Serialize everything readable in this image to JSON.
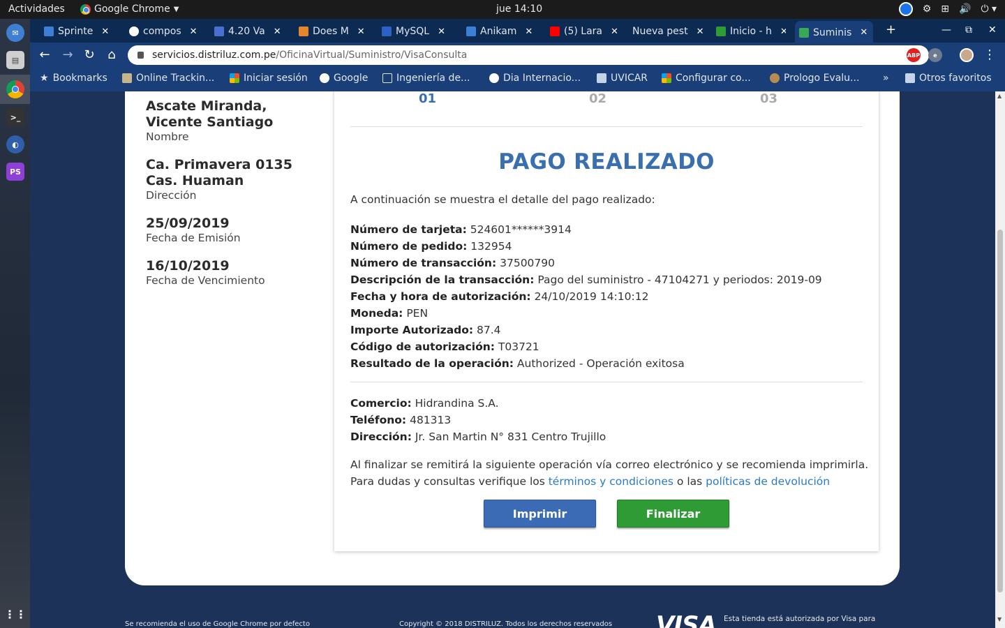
{
  "topbar": {
    "activities": "Actividades",
    "app_name": "Google Chrome",
    "clock": "jue 14:10"
  },
  "tabs": [
    {
      "label": "Sprinte",
      "color": "#3d7fd4"
    },
    {
      "label": "compos",
      "color": "#ffffff"
    },
    {
      "label": "4.20 Va",
      "color": "#4a6fd1"
    },
    {
      "label": "Does M",
      "color": "#e6862c"
    },
    {
      "label": "MySQL",
      "color": "#2d62c4"
    },
    {
      "label": "Anikam",
      "color": "#3d7fd4"
    },
    {
      "label": "(5) Lara",
      "color": "#ff0000"
    },
    {
      "label": "Nueva pest",
      "color": ""
    },
    {
      "label": "Inicio - h",
      "color": "#2e9b34"
    },
    {
      "label": "Suminis",
      "color": "#3aa957"
    }
  ],
  "omnibox": {
    "domain": "servicios.distriluz.com.pe",
    "path": "/OficinaVirtual/Suministro/VisaConsulta"
  },
  "bookmarks": [
    {
      "label": "Bookmarks"
    },
    {
      "label": "Online Trackin..."
    },
    {
      "label": "Iniciar sesión"
    },
    {
      "label": "Google"
    },
    {
      "label": "Ingeniería de..."
    },
    {
      "label": "Dia Internacio..."
    },
    {
      "label": "UVICAR"
    },
    {
      "label": "Configurar co..."
    },
    {
      "label": "Prologo Evalu..."
    },
    {
      "label": "Otros favoritos"
    }
  ],
  "customer": {
    "name": "Ascate Miranda, Vicente Santiago",
    "name_label": "Nombre",
    "address": "Ca. Primavera 0135 Cas. Huaman",
    "address_label": "Dirección",
    "issue_date": "25/09/2019",
    "issue_label": "Fecha de Emisión",
    "due_date": "16/10/2019",
    "due_label": "Fecha de Vencimiento"
  },
  "steps": [
    "01",
    "02",
    "03"
  ],
  "payment": {
    "title": "PAGO REALIZADO",
    "intro": "A continuación se muestra el detalle del pago realizado:",
    "rows": [
      {
        "label": "Número de tarjeta:",
        "value": "524601******3914"
      },
      {
        "label": "Número de pedido:",
        "value": "132954"
      },
      {
        "label": "Número de transacción:",
        "value": "37500790"
      },
      {
        "label": "Descripción de la transacción:",
        "value": "Pago del suministro - 47104271 y periodos: 2019-09"
      },
      {
        "label": "Fecha y hora de autorización:",
        "value": "24/10/2019 14:10:12"
      },
      {
        "label": "Moneda:",
        "value": "PEN"
      },
      {
        "label": "Importe Autorizado:",
        "value": "87.4"
      },
      {
        "label": "Código de autorización:",
        "value": "T03721"
      },
      {
        "label": "Resultado de la operación:",
        "value": "Authorized - Operación exitosa"
      }
    ],
    "merchant": [
      {
        "label": "Comercio:",
        "value": "Hidrandina S.A."
      },
      {
        "label": "Teléfono:",
        "value": "481313"
      },
      {
        "label": "Dirección:",
        "value": "Jr. San Martin N° 831 Centro Trujillo"
      }
    ],
    "note_line1": "Al finalizar se remitirá la siguiente operación vía correo electrónico y se recomienda imprimirla.",
    "note_line2_a": "Para dudas y consultas verifique los ",
    "terms_link": "términos y condiciones",
    "note_line2_b": " o las ",
    "returns_link": "políticas de devolución",
    "print_button": "Imprimir",
    "finish_button": "Finalizar"
  },
  "footer": {
    "browser_note": "Se recomienda el uso de Google Chrome por defecto",
    "copyright": "Copyright © 2018 DISTRILUZ. Todos los derechos reservados",
    "visa_logo": "VISA",
    "visa_note": "Esta tienda está autorizada por Visa para"
  },
  "colors": {
    "title_blue": "#3a6faf",
    "link_blue": "#2a7ac9",
    "print_button": "#3c6bb5",
    "finish_button": "#2e9b34",
    "page_background": "#1c3258"
  }
}
